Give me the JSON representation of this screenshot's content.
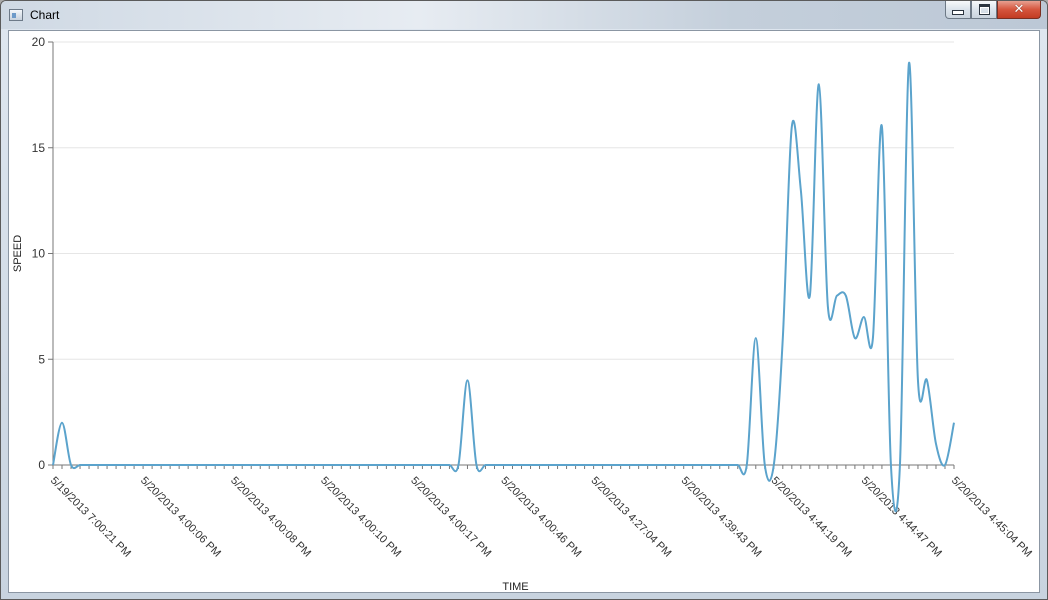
{
  "window": {
    "title": "Chart",
    "minimize_icon": "minimize-icon",
    "maximize_icon": "maximize-icon",
    "close_icon": "close-icon",
    "close_glyph": "✕"
  },
  "chart_data": {
    "type": "line",
    "title": "",
    "xlabel": "TIME",
    "ylabel": "SPEED",
    "ylim": [
      0,
      20
    ],
    "yticks": [
      0,
      5,
      10,
      15,
      20
    ],
    "grid": true,
    "line_color": "#5ba3cc",
    "x_tick_labels": [
      "5/19/2013 7:00:21 PM",
      "5/20/2013 4:00:06 PM",
      "5/20/2013 4:00:08 PM",
      "5/20/2013 4:00:10 PM",
      "5/20/2013 4:00:17 PM",
      "5/20/2013 4:00:46 PM",
      "5/20/2013 4:27:04 PM",
      "5/20/2013 4:39:43 PM",
      "5/20/2013 4:44:19 PM",
      "5/20/2013 4:44:47 PM",
      "5/20/2013 4:45:04 PM"
    ],
    "point_count": 101,
    "series": [
      {
        "values": [
          0,
          2,
          0,
          0,
          0,
          0,
          0,
          0,
          0,
          0,
          0,
          0,
          0,
          0,
          0,
          0,
          0,
          0,
          0,
          0,
          0,
          0,
          0,
          0,
          0,
          0,
          0,
          0,
          0,
          0,
          0,
          0,
          0,
          0,
          0,
          0,
          0,
          0,
          0,
          0,
          0,
          0,
          0,
          0,
          0,
          0,
          4,
          0,
          0,
          0,
          0,
          0,
          0,
          0,
          0,
          0,
          0,
          0,
          0,
          0,
          0,
          0,
          0,
          0,
          0,
          0,
          0,
          0,
          0,
          0,
          0,
          0,
          0,
          0,
          0,
          0,
          0,
          0,
          6,
          0,
          0,
          6,
          16,
          13,
          8,
          18,
          7.5,
          8,
          8,
          6,
          7,
          6,
          16,
          0,
          0,
          19,
          4,
          4,
          1,
          0,
          2
        ]
      }
    ]
  }
}
